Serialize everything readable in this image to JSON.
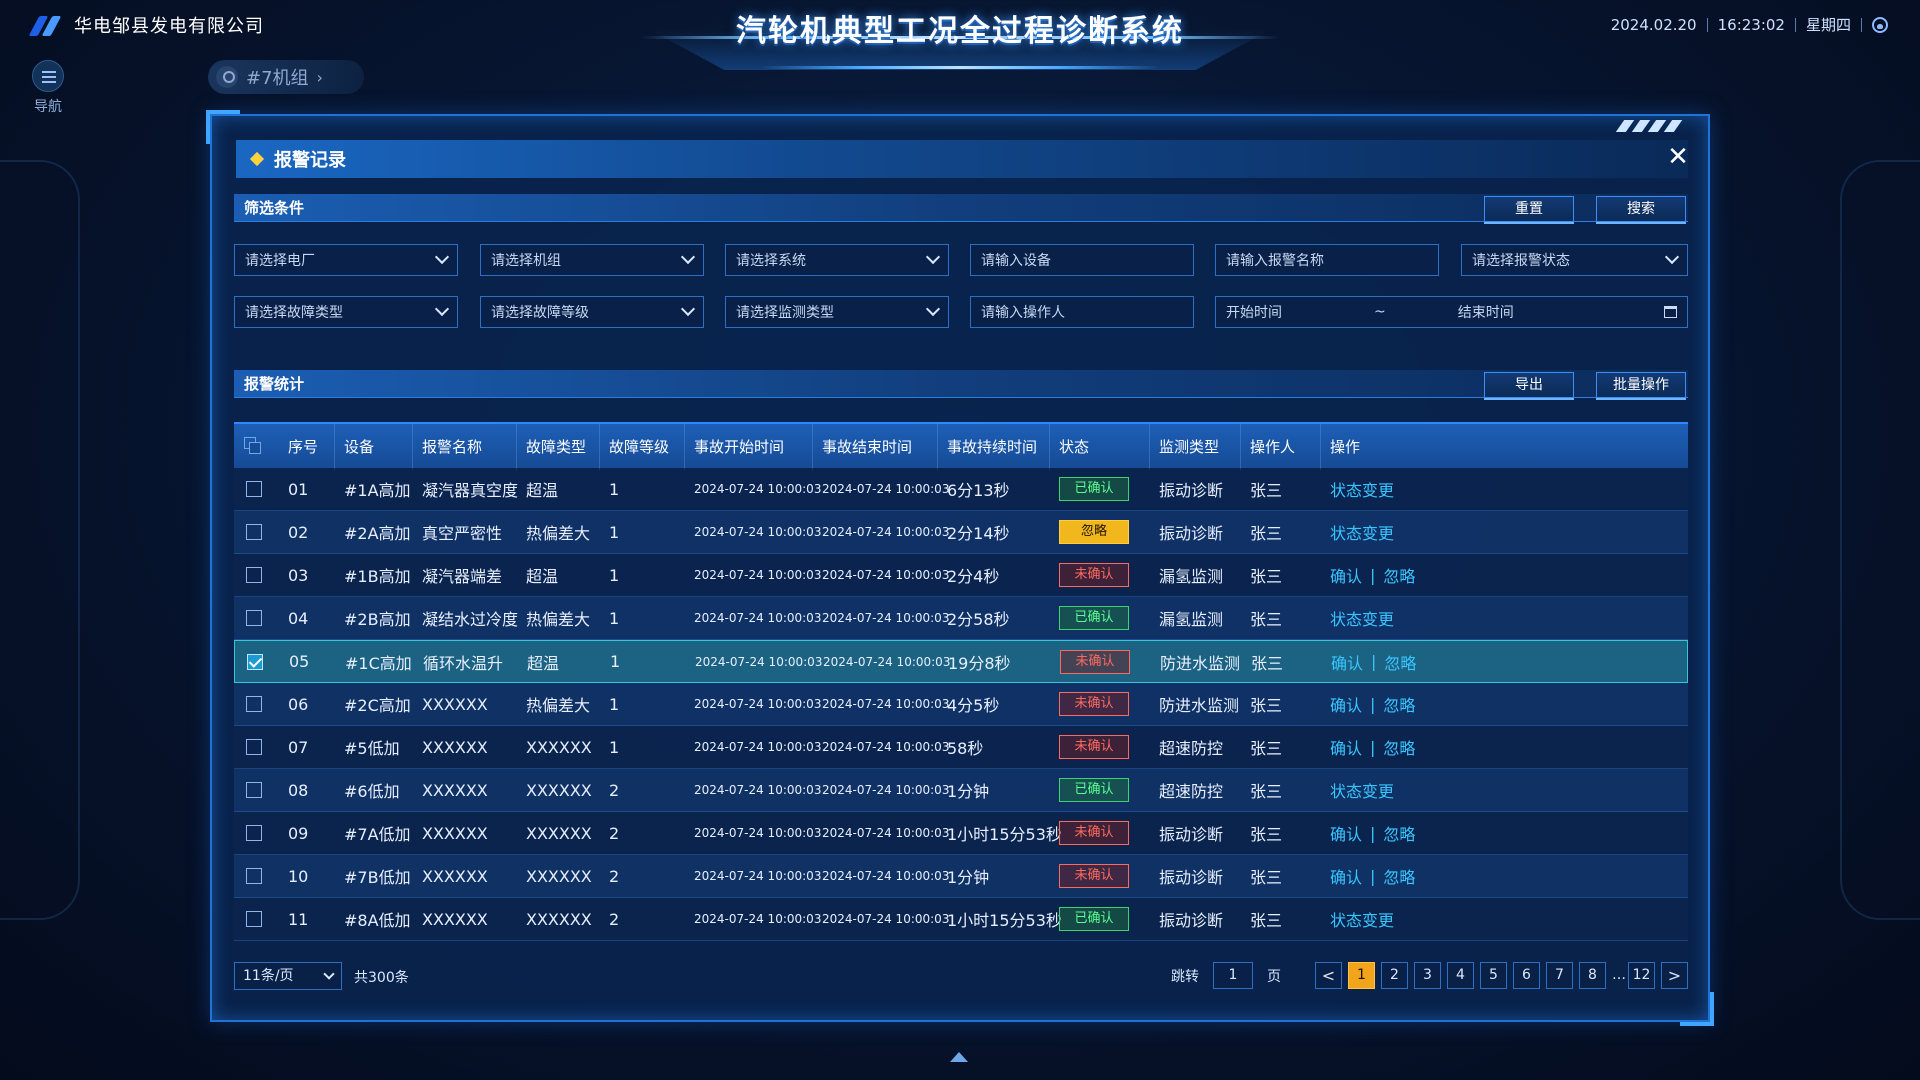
{
  "header": {
    "company": "华电邹县发电有限公司",
    "system_title": "汽轮机典型工况全过程诊断系统",
    "date": "2024.02.20",
    "time": "16:23:02",
    "weekday": "星期四"
  },
  "nav": {
    "label": "导航",
    "unit": "#7机组"
  },
  "modal": {
    "title": "报警记录",
    "filter_title": "筛选条件",
    "reset": "重置",
    "search": "搜索",
    "stats_title": "报警统计",
    "export": "导出",
    "batch": "批量操作",
    "filters": {
      "plant": "请选择电厂",
      "unit": "请选择机组",
      "system": "请选择系统",
      "device": "请输入设备",
      "alarm_name": "请输入报警名称",
      "alarm_status": "请选择报警状态",
      "fault_type": "请选择故障类型",
      "fault_level": "请选择故障等级",
      "monitor_type": "请选择监测类型",
      "operator": "请输入操作人",
      "start_time": "开始时间",
      "tilde": "~",
      "end_time": "结束时间"
    },
    "columns": [
      "序号",
      "设备",
      "报警名称",
      "故障类型",
      "故障等级",
      "事故开始时间",
      "事故结束时间",
      "事故持续时间",
      "状态",
      "监测类型",
      "操作人",
      "操作"
    ],
    "rows": [
      {
        "no": "01",
        "device": "#1A高加",
        "name": "凝汽器真空度",
        "ftype": "超温",
        "level": "1",
        "start": "2024-07-24  10:00:03",
        "end": "2024-07-24  10:00:03",
        "dur": "6分13秒",
        "status": "已确认",
        "skind": "ok",
        "mtype": "振动诊断",
        "op": "张三",
        "actions": [
          "状态变更"
        ],
        "checked": false
      },
      {
        "no": "02",
        "device": "#2A高加",
        "name": "真空严密性",
        "ftype": "热偏差大",
        "level": "1",
        "start": "2024-07-24  10:00:03",
        "end": "2024-07-24  10:00:03",
        "dur": "2分14秒",
        "status": "忽略",
        "skind": "ig",
        "mtype": "振动诊断",
        "op": "张三",
        "actions": [
          "状态变更"
        ],
        "checked": false
      },
      {
        "no": "03",
        "device": "#1B高加",
        "name": "凝汽器端差",
        "ftype": "超温",
        "level": "1",
        "start": "2024-07-24  10:00:03",
        "end": "2024-07-24  10:00:03",
        "dur": "2分4秒",
        "status": "未确认",
        "skind": "un",
        "mtype": "漏氢监测",
        "op": "张三",
        "actions": [
          "确认",
          "忽略"
        ],
        "checked": false
      },
      {
        "no": "04",
        "device": "#2B高加",
        "name": "凝结水过冷度",
        "ftype": "热偏差大",
        "level": "1",
        "start": "2024-07-24  10:00:03",
        "end": "2024-07-24  10:00:03",
        "dur": "2分58秒",
        "status": "已确认",
        "skind": "ok",
        "mtype": "漏氢监测",
        "op": "张三",
        "actions": [
          "状态变更"
        ],
        "checked": false
      },
      {
        "no": "05",
        "device": "#1C高加",
        "name": "循环水温升",
        "ftype": "超温",
        "level": "1",
        "start": "2024-07-24  10:00:03",
        "end": "2024-07-24  10:00:03",
        "dur": "19分8秒",
        "status": "未确认",
        "skind": "un",
        "mtype": "防进水监测",
        "op": "张三",
        "actions": [
          "确认",
          "忽略"
        ],
        "checked": true
      },
      {
        "no": "06",
        "device": "#2C高加",
        "name": "XXXXXX",
        "ftype": "热偏差大",
        "level": "1",
        "start": "2024-07-24  10:00:03",
        "end": "2024-07-24  10:00:03",
        "dur": "4分5秒",
        "status": "未确认",
        "skind": "un",
        "mtype": "防进水监测",
        "op": "张三",
        "actions": [
          "确认",
          "忽略"
        ],
        "checked": false
      },
      {
        "no": "07",
        "device": "#5低加",
        "name": "XXXXXX",
        "ftype": "XXXXXX",
        "level": "1",
        "start": "2024-07-24  10:00:03",
        "end": "2024-07-24  10:00:03",
        "dur": "58秒",
        "status": "未确认",
        "skind": "un",
        "mtype": "超速防控",
        "op": "张三",
        "actions": [
          "确认",
          "忽略"
        ],
        "checked": false
      },
      {
        "no": "08",
        "device": "#6低加",
        "name": "XXXXXX",
        "ftype": "XXXXXX",
        "level": "2",
        "start": "2024-07-24  10:00:03",
        "end": "2024-07-24  10:00:03",
        "dur": "1分钟",
        "status": "已确认",
        "skind": "ok",
        "mtype": "超速防控",
        "op": "张三",
        "actions": [
          "状态变更"
        ],
        "checked": false
      },
      {
        "no": "09",
        "device": "#7A低加",
        "name": "XXXXXX",
        "ftype": "XXXXXX",
        "level": "2",
        "start": "2024-07-24  10:00:03",
        "end": "2024-07-24  10:00:03",
        "dur": "1小时15分53秒",
        "status": "未确认",
        "skind": "un",
        "mtype": "振动诊断",
        "op": "张三",
        "actions": [
          "确认",
          "忽略"
        ],
        "checked": false
      },
      {
        "no": "10",
        "device": "#7B低加",
        "name": "XXXXXX",
        "ftype": "XXXXXX",
        "level": "2",
        "start": "2024-07-24  10:00:03",
        "end": "2024-07-24  10:00:03",
        "dur": "1分钟",
        "status": "未确认",
        "skind": "un",
        "mtype": "振动诊断",
        "op": "张三",
        "actions": [
          "确认",
          "忽略"
        ],
        "checked": false
      },
      {
        "no": "11",
        "device": "#8A低加",
        "name": "XXXXXX",
        "ftype": "XXXXXX",
        "level": "2",
        "start": "2024-07-24  10:00:03",
        "end": "2024-07-24  10:00:03",
        "dur": "1小时15分53秒",
        "status": "已确认",
        "skind": "ok",
        "mtype": "振动诊断",
        "op": "张三",
        "actions": [
          "状态变更"
        ],
        "checked": false
      }
    ],
    "pager": {
      "size": "11条/页",
      "total": "共300条",
      "jump_label": "跳转",
      "jump_value": "1",
      "page_unit": "页",
      "prev": "<",
      "next": ">",
      "pages": [
        "1",
        "2",
        "3",
        "4",
        "5",
        "6",
        "7",
        "8",
        "…",
        "12"
      ],
      "current": "1"
    }
  },
  "colors": {
    "accent": "#1f72d8",
    "confirmed": "#3cd46a",
    "ignored": "#f2b71c",
    "unconfirmed": "#ff6a5c",
    "link": "#39c6ff"
  }
}
